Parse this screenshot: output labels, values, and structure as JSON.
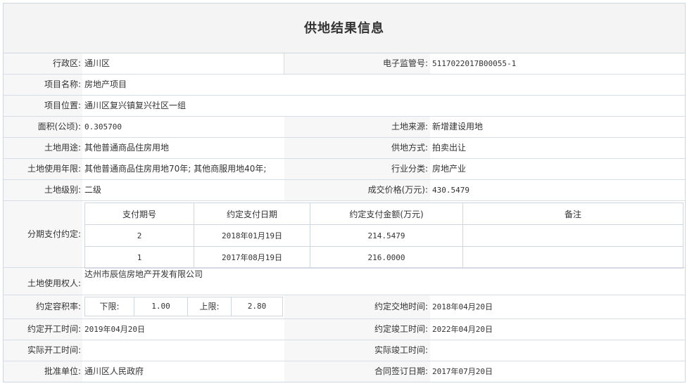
{
  "title": "供地结果信息",
  "district": {
    "label": "行政区:",
    "value": "通川区"
  },
  "supervision_no": {
    "label": "电子监管号:",
    "value": "5117022017B00055-1"
  },
  "project_name": {
    "label": "项目名称:",
    "value": "房地产项目"
  },
  "project_location": {
    "label": "项目位置:",
    "value": "通川区复兴镇复兴社区一组"
  },
  "area": {
    "label": "面积(公顷):",
    "value": "0.305700"
  },
  "land_source": {
    "label": "土地来源:",
    "value": "新增建设用地"
  },
  "land_use": {
    "label": "土地用途:",
    "value": "其他普通商品住房用地"
  },
  "supply_method": {
    "label": "供地方式:",
    "value": "拍卖出让"
  },
  "use_term": {
    "label": "土地使用年限:",
    "value": "其他普通商品住房用地70年; 其他商服用地40年;"
  },
  "industry": {
    "label": "行业分类:",
    "value": "房地产业"
  },
  "land_grade": {
    "label": "土地级别:",
    "value": "二级"
  },
  "price": {
    "label": "成交价格(万元):",
    "value": "430.5479"
  },
  "installments": {
    "label": "分期支付约定:",
    "headers": [
      "支付期号",
      "约定支付日期",
      "约定支付金额(万元)",
      "备注"
    ],
    "rows": [
      {
        "period": "2",
        "date": "2018年01月19日",
        "amount": "214.5479",
        "note": ""
      },
      {
        "period": "1",
        "date": "2017年08月19日",
        "amount": "216.0000",
        "note": ""
      }
    ]
  },
  "land_user": {
    "label": "土地使用权人:",
    "value": "达州市辰信房地产开发有限公司"
  },
  "far": {
    "label": "约定容积率:",
    "lower_label": "下限:",
    "lower": "1.00",
    "upper_label": "上限:",
    "upper": "2.80"
  },
  "delivery_time": {
    "label": "约定交地时间:",
    "value": "2018年04月20日"
  },
  "start_time": {
    "label": "约定开工时间:",
    "value": "2019年04月20日"
  },
  "completion_time": {
    "label": "约定竣工时间:",
    "value": "2022年04月20日"
  },
  "actual_start": {
    "label": "实际开工时间:",
    "value": ""
  },
  "actual_completion": {
    "label": "实际竣工时间:",
    "value": ""
  },
  "approval_unit": {
    "label": "批准单位:",
    "value": "通川区人民政府"
  },
  "contract_date": {
    "label": "合同签订日期:",
    "value": "2017年07月20日"
  }
}
